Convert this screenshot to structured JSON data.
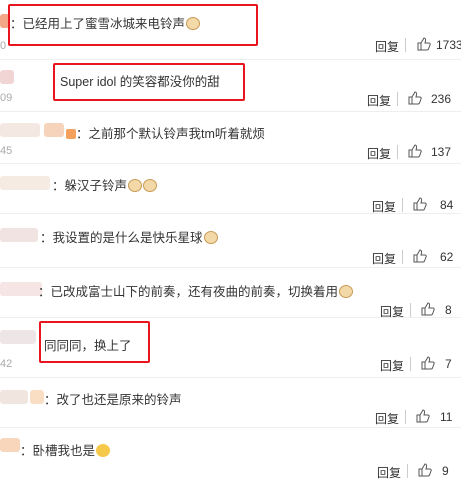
{
  "ui": {
    "reply_label": "回复",
    "accent": "#e8141e"
  },
  "comments": [
    {
      "text": "已经用上了蜜雪冰城来电铃声",
      "ts": "0",
      "likes": "1733",
      "avatar_color": "#f08a5d"
    },
    {
      "text": "Super idol 的笑容都没你的甜",
      "ts": "09",
      "likes": "236",
      "avatar_color": "#e9b8b8"
    },
    {
      "text": "之前那个默认铃声我tm听着就烦",
      "ts": "45",
      "likes": "137",
      "avatar_color": "#f3c6a4"
    },
    {
      "text": "躲汉子铃声",
      "ts": "",
      "likes": "84",
      "avatar_color": "#f2d2b4"
    },
    {
      "text": "我设置的是什么是快乐星球",
      "ts": "",
      "likes": "62",
      "avatar_color": "#e6c6c6"
    },
    {
      "text": "已改成富士山下的前奏，还有夜曲的前奏，切换着用",
      "ts": "",
      "likes": "8",
      "avatar_color": "#f2c4c0"
    },
    {
      "text": "同同同，换上了",
      "ts": "42",
      "likes": "7",
      "avatar_color": "#e0d0d0"
    },
    {
      "text": "改了也还是原来的铃声",
      "ts": "",
      "likes": "11",
      "avatar_color": "#f7d3b0"
    },
    {
      "text": "卧槽我也是",
      "ts": "",
      "likes": "9",
      "avatar_color": "#f5c8a5"
    }
  ]
}
